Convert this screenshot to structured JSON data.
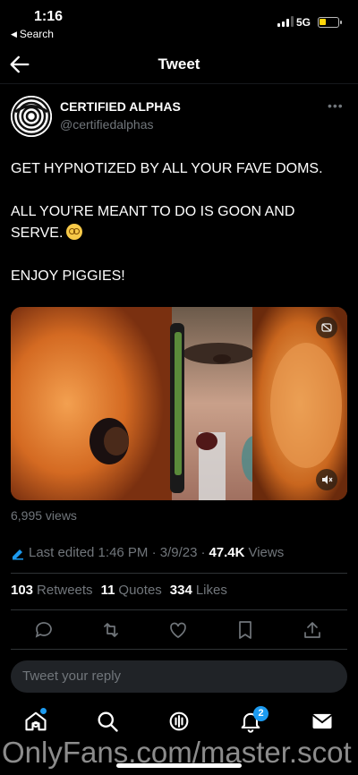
{
  "status_bar": {
    "time": "1:16",
    "back_app": "Search",
    "network": "5G"
  },
  "header": {
    "title": "Tweet"
  },
  "tweet": {
    "author_name": "CERTIFIED ALPHAS",
    "handle": "@certifiedalphas",
    "text_lines": [
      "GET HYPNOTIZED BY ALL YOUR FAVE DOMS.",
      "ALL YOU’RE MEANT TO DO IS GOON AND",
      "SERVE.",
      "ENJOY PIGGIES!"
    ],
    "video_views": "6,995 views",
    "edited_label": "Last edited 1:46 PM · 3/9/23",
    "views_count": "47.4K",
    "views_label": "Views",
    "retweets_count": "103",
    "retweets_label": "Retweets",
    "quotes_count": "11",
    "quotes_label": "Quotes",
    "likes_count": "334",
    "likes_label": "Likes"
  },
  "reply": {
    "placeholder": "Tweet your reply"
  },
  "tabbar": {
    "notifications_badge": "2"
  },
  "watermark": "OnlyFans.com/master.scot",
  "colors": {
    "accent": "#1d9bf0",
    "background": "#000000",
    "muted": "#71767b"
  }
}
